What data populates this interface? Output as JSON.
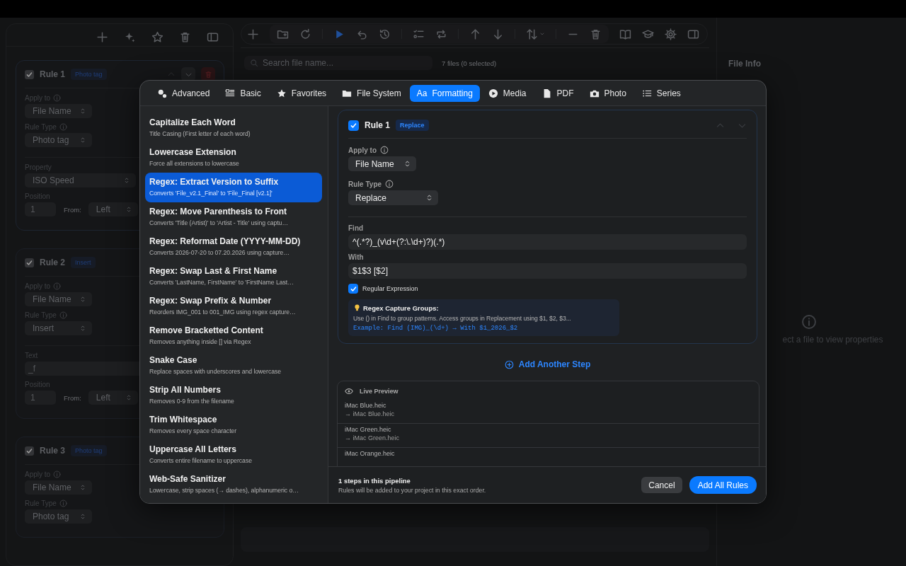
{
  "sidebar": {
    "rules": [
      {
        "title": "Rule 1",
        "checked": true,
        "badge": "Photo tag",
        "hovered": true,
        "fields": [
          {
            "kind": "select",
            "label": "Apply to",
            "value": "File Name"
          },
          {
            "kind": "select",
            "label": "Rule Type",
            "value": "Photo tag"
          },
          {
            "kind": "wide-select",
            "label": "Property",
            "value": "ISO Speed"
          },
          {
            "kind": "position",
            "label": "Position",
            "value": "1",
            "from_label": "From:",
            "from_value": "Left"
          }
        ]
      },
      {
        "title": "Rule 2",
        "checked": true,
        "badge": "Insert",
        "hovered": false,
        "fields": [
          {
            "kind": "select",
            "label": "Apply to",
            "value": "File Name"
          },
          {
            "kind": "select",
            "label": "Rule Type",
            "value": "Insert"
          },
          {
            "kind": "text",
            "label": "Text",
            "value": "_f"
          },
          {
            "kind": "position",
            "label": "Position",
            "value": "1",
            "from_label": "From:",
            "from_value": "Left"
          }
        ]
      },
      {
        "title": "Rule 3",
        "checked": true,
        "badge": "Photo tag",
        "hovered": false,
        "fields": [
          {
            "kind": "select",
            "label": "Apply to",
            "value": "File Name"
          },
          {
            "kind": "select",
            "label": "Rule Type",
            "value": "Photo tag"
          }
        ]
      }
    ]
  },
  "main": {
    "search": {
      "placeholder": "Search file name..."
    },
    "file_count": "7 files (0 selected)"
  },
  "file_info": {
    "title": "File Info",
    "empty_text": "ect a file to view properties"
  },
  "dialog": {
    "tabs": [
      {
        "label": "Advanced",
        "selected": false
      },
      {
        "label": "Basic",
        "selected": false
      },
      {
        "label": "Favorites",
        "selected": false
      },
      {
        "label": "File System",
        "selected": false
      },
      {
        "label": "Formatting",
        "glyph": "Aa",
        "selected": true
      },
      {
        "label": "Media",
        "selected": false
      },
      {
        "label": "PDF",
        "selected": false
      },
      {
        "label": "Photo",
        "selected": false
      },
      {
        "label": "Series",
        "selected": false
      }
    ],
    "presets": [
      {
        "title": "Capitalize Each Word",
        "description": "Title Casing (First letter of each word)",
        "selected": false
      },
      {
        "title": "Lowercase Extension",
        "description": "Force all extensions to lowercase",
        "selected": false
      },
      {
        "title": "Regex: Extract Version to Suffix",
        "description": "Converts 'File_v2.1_Final' to 'File_Final [v2.1]'",
        "selected": true
      },
      {
        "title": "Regex: Move Parenthesis to Front",
        "description": "Converts 'Title (Artist)' to 'Artist - Title' using captu…",
        "selected": false
      },
      {
        "title": "Regex: Reformat Date (YYYY-MM-DD)",
        "description": "Converts 2026-07-20 to 07.20.2026 using capture…",
        "selected": false
      },
      {
        "title": "Regex: Swap Last & First Name",
        "description": "Converts 'LastName, FirstName' to 'FirstName Last…",
        "selected": false
      },
      {
        "title": "Regex: Swap Prefix & Number",
        "description": "Reorders IMG_001 to 001_IMG using regex capture…",
        "selected": false
      },
      {
        "title": "Remove Bracketted Content",
        "description": "Removes anything inside [] via Regex",
        "selected": false
      },
      {
        "title": "Snake Case",
        "description": "Replace spaces with underscores and lowercase",
        "selected": false
      },
      {
        "title": "Strip All Numbers",
        "description": "Removes 0-9 from the filename",
        "selected": false
      },
      {
        "title": "Trim Whitespace",
        "description": "Removes every space character",
        "selected": false
      },
      {
        "title": "Uppercase All Letters",
        "description": "Converts entire filename to uppercase",
        "selected": false
      },
      {
        "title": "Web-Safe Sanitizer",
        "description": "Lowercase, strip spaces (→ dashes), alphanumeric o…",
        "selected": false
      }
    ],
    "rule": {
      "title": "Rule 1",
      "checked": true,
      "badge": "Replace",
      "apply_label": "Apply to",
      "apply_value": "File Name",
      "type_label": "Rule Type",
      "type_value": "Replace",
      "find_label": "Find",
      "find_value": "^(.*?)_(v\\d+(?:\\.\\d+)?)(.*)",
      "with_label": "With",
      "with_value": "$1$3 [$2]",
      "regex_label": "Regular Expression",
      "regex_checked": true,
      "hint": {
        "title": "Regex Capture Groups:",
        "text": "Use () in Find to group patterns. Access groups in Replacement using $1, $2, $3...",
        "example": "Example: Find (IMG)_(\\d+) → With $1_2026_$2"
      }
    },
    "add_step": "Add Another Step",
    "preview": {
      "title": "Live Preview",
      "rows": [
        {
          "from": "iMac Blue.heic",
          "to": "→ iMac Blue.heic"
        },
        {
          "from": "iMac Green.heic",
          "to": "→ iMac Green.heic"
        },
        {
          "from": "iMac Orange.heic"
        }
      ]
    },
    "footer": {
      "title": "1 steps in this pipeline",
      "subtitle": "Rules will be added to your project in this exact order.",
      "buttons": [
        {
          "label": "Cancel",
          "primary": false
        },
        {
          "label": "Add All Rules",
          "primary": true
        }
      ]
    }
  }
}
